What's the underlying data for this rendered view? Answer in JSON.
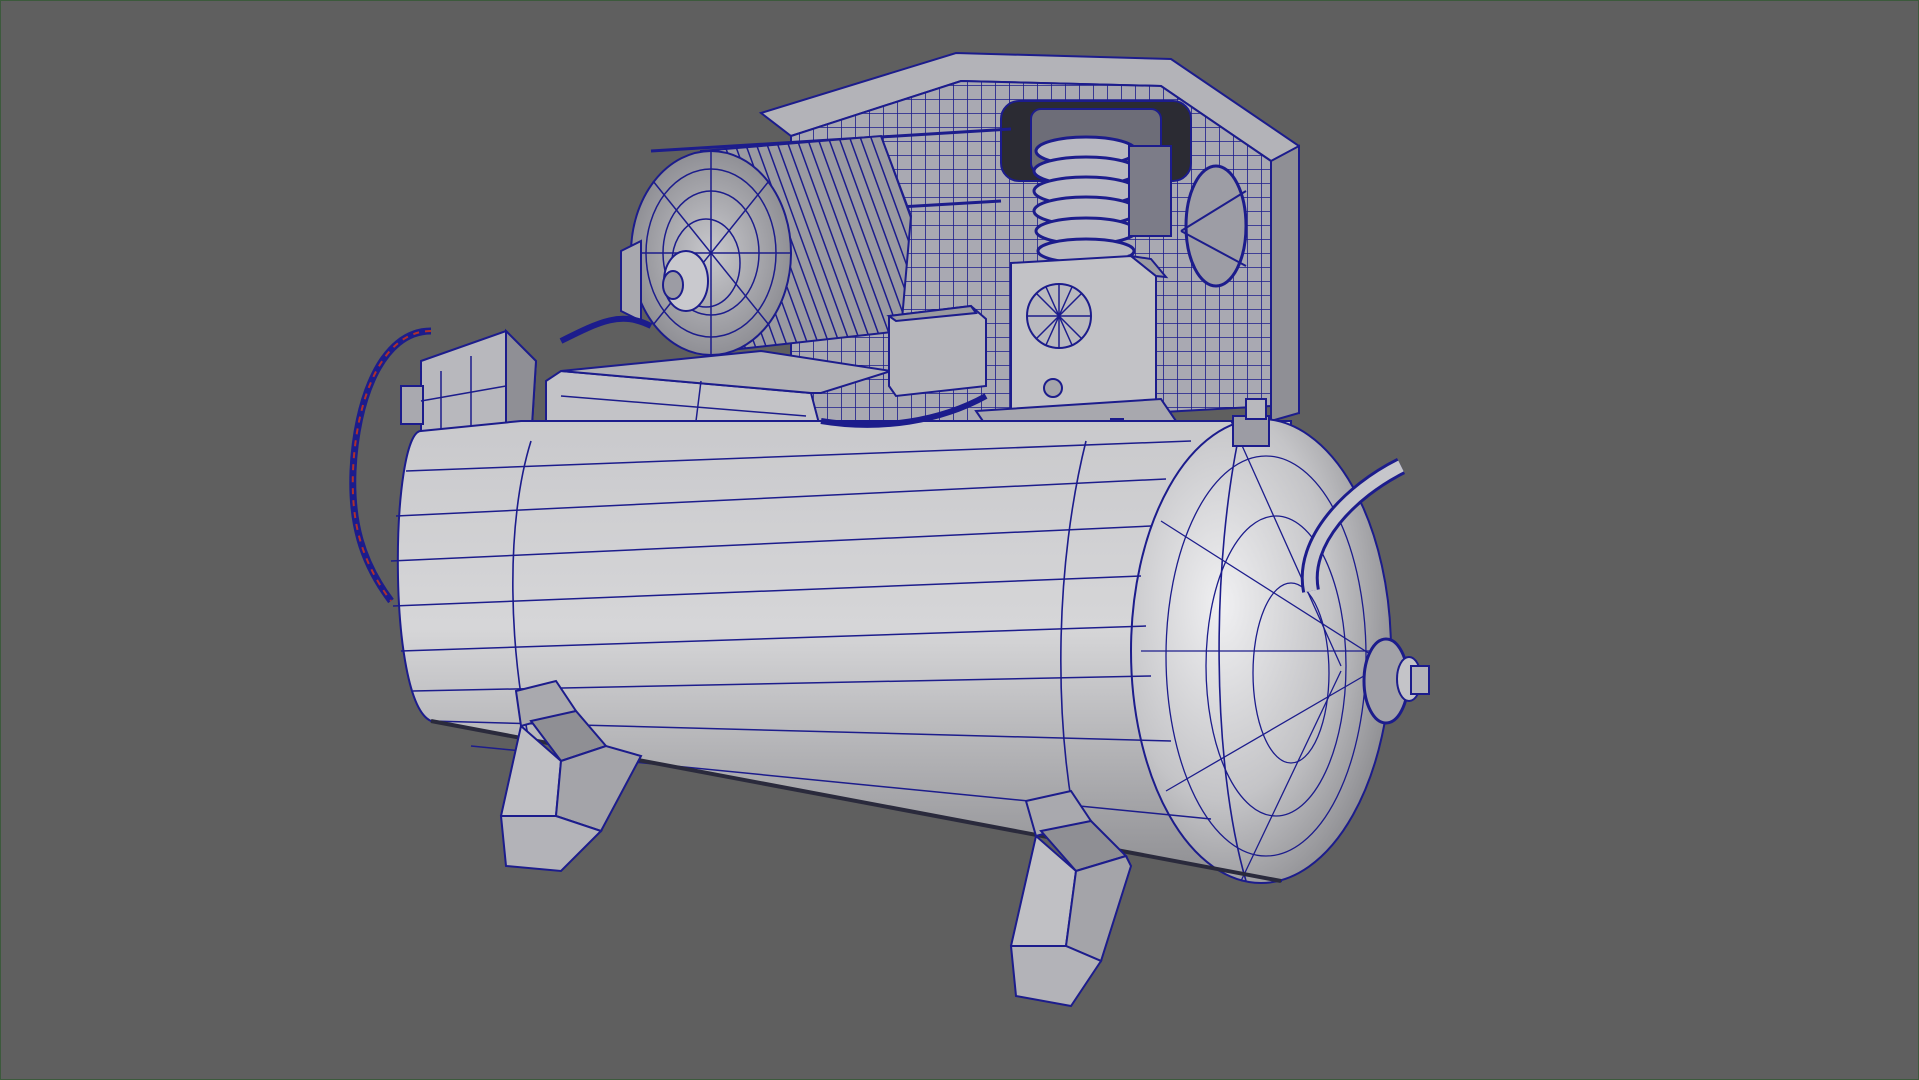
{
  "viewport": {
    "background": "#5f5f5f",
    "border": "#3c5a3c",
    "wire_color": "#1c1c8c",
    "shade_light": "#d4d4d6",
    "shade_mid": "#b7b7ba",
    "shade_dark": "#8f8f93",
    "accent_wire": "#b0302a"
  },
  "object": {
    "icon": "air-compressor-wireframe",
    "display_mode": "wireframe-on-shaded"
  }
}
